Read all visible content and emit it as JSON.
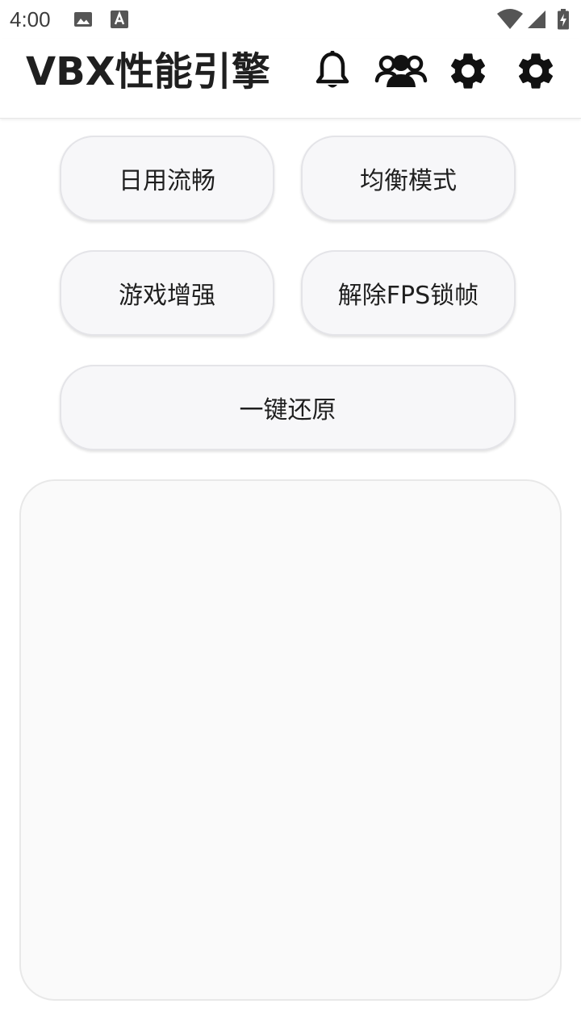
{
  "status_bar": {
    "time": "4:00",
    "left_icons": [
      "image-icon",
      "app-notification-icon"
    ],
    "right_icons": [
      "wifi-icon",
      "cellular-icon",
      "battery-charging-icon"
    ]
  },
  "app_bar": {
    "title": "VBX性能引擎",
    "actions": [
      "bell-icon",
      "group-icon",
      "gear-icon",
      "gear-icon"
    ]
  },
  "modes": {
    "daily": "日用流畅",
    "balanced": "均衡模式",
    "game": "游戏增强",
    "unlock_fps": "解除FPS锁帧",
    "restore": "一键还原"
  },
  "log_panel": {
    "text": ""
  },
  "colors": {
    "background": "#ffffff",
    "button_fill": "#f7f7f9",
    "button_border": "#e4e4e8",
    "text": "#1f1f1f"
  }
}
